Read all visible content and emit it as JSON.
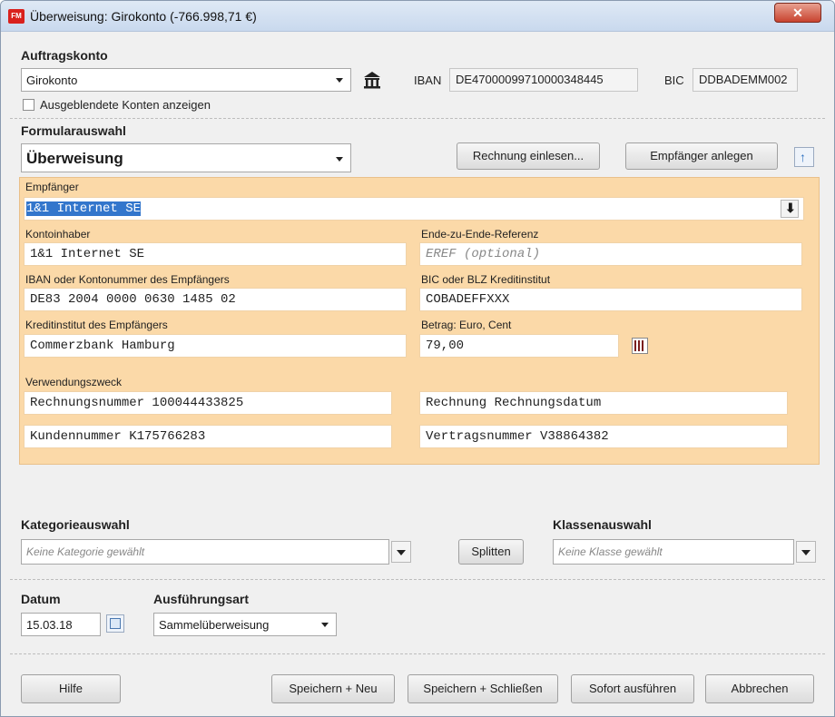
{
  "window": {
    "title": "Überweisung: Girokonto (-766.998,71 €)",
    "app_icon": "FM",
    "close_icon": "x-icon"
  },
  "auftragskonto": {
    "label": "Auftragskonto",
    "account": "Girokonto",
    "iban_label": "IBAN",
    "iban": "DE47000099710000348445",
    "bic_label": "BIC",
    "bic": "DDBADEMM002",
    "hidden_accounts_label": "Ausgeblendete Konten anzeigen",
    "hidden_accounts_checked": false
  },
  "formular": {
    "label": "Formularauswahl",
    "value": "Überweisung",
    "buttons": {
      "rechnung": "Rechnung einlesen...",
      "empfaenger": "Empfänger anlegen"
    }
  },
  "form": {
    "empfaenger_label": "Empfänger",
    "empfaenger": "1&1 Internet SE",
    "kontoinhaber_label": "Kontoinhaber",
    "kontoinhaber": "1&1 Internet SE",
    "eref_label": "Ende-zu-Ende-Referenz",
    "eref_placeholder": "EREF (optional)",
    "iban_label": "IBAN oder Kontonummer des Empfängers",
    "iban": "DE83 2004 0000 0630 1485 02",
    "bic_label": "BIC oder BLZ Kreditinstitut",
    "bic": "COBADEFFXXX",
    "bank_label": "Kreditinstitut des Empfängers",
    "bank": "Commerzbank Hamburg",
    "betrag_label": "Betrag: Euro, Cent",
    "betrag": "79,00",
    "verwendung_label": "Verwendungszweck",
    "verwendung": [
      "Rechnungsnummer 100044433825",
      "Rechnung Rechnungsdatum",
      "Kundennummer K175766283",
      "Vertragsnummer V38864382"
    ]
  },
  "kategorie": {
    "label": "Kategorieauswahl",
    "placeholder": "Keine Kategorie gewählt"
  },
  "splitten": "Splitten",
  "klasse": {
    "label": "Klassenauswahl",
    "placeholder": "Keine Klasse gewählt"
  },
  "datum": {
    "label": "Datum",
    "value": "15.03.18"
  },
  "ausfuehrung": {
    "label": "Ausführungsart",
    "value": "Sammelüberweisung"
  },
  "footer": {
    "hilfe": "Hilfe",
    "speichern_neu": "Speichern + Neu",
    "speichern_schliessen": "Speichern + Schließen",
    "sofort": "Sofort ausführen",
    "abbrechen": "Abbrechen"
  }
}
